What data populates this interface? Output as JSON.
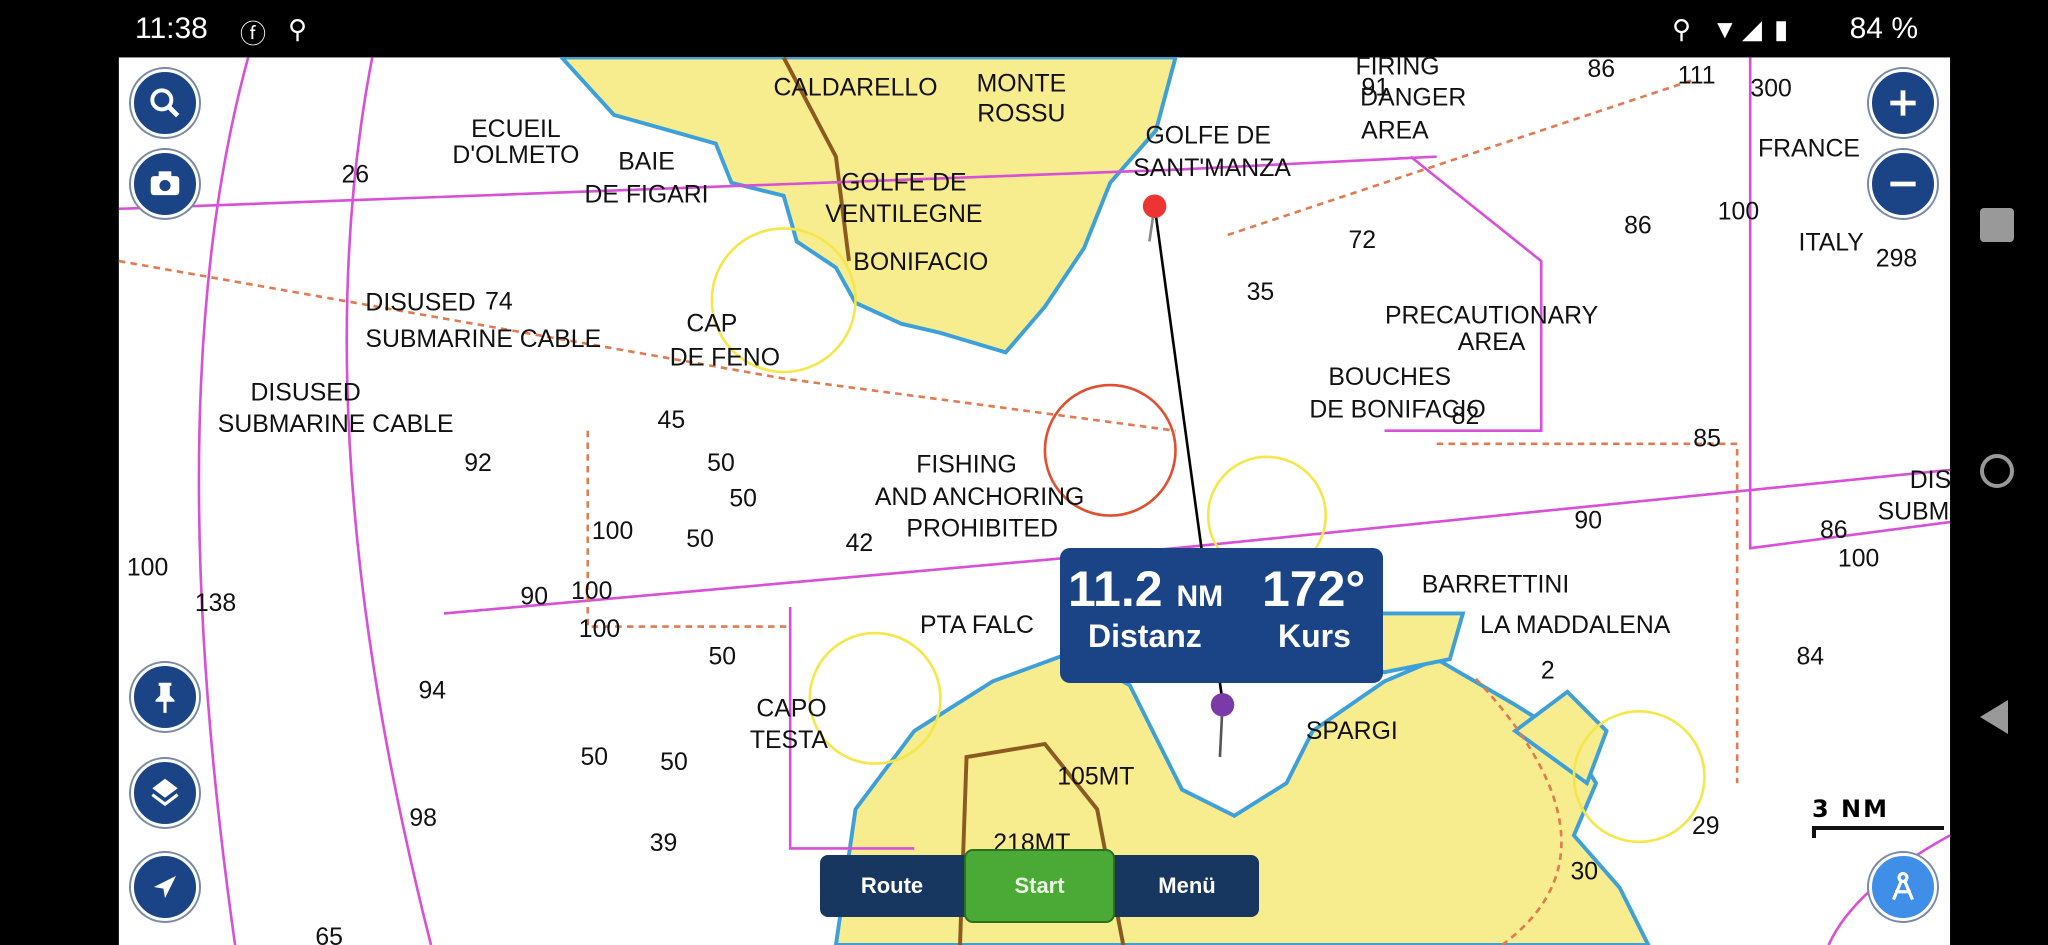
{
  "status_bar": {
    "time": "11:38",
    "battery": "84 %",
    "icons": [
      "facebook-icon",
      "location-icon",
      "location-outline-icon",
      "wifi-icon",
      "signal-icon",
      "battery-icon"
    ]
  },
  "map": {
    "labels": [
      "ECUEIL",
      "D'OLMETO",
      "BAIE",
      "DE FIGARI",
      "MONTE",
      "ROSSU",
      "CALDARELLO",
      "GOLFE DE",
      "SANT'MANZA",
      "FIRING",
      "DANGER",
      "AREA",
      "FRANCE",
      "ITALY",
      "GOLFE DE",
      "VENTILEGNE",
      "BONIFACIO",
      "DISUSED",
      "SUBMARINE CABLE",
      "DISUSED",
      "SUBMARINE CABLE",
      "CAP",
      "DE FENO",
      "PRECAUTIONARY",
      "AREA",
      "BOUCHES",
      "DE BONIFACIO",
      "FISHING",
      "AND ANCHORING",
      "PROHIBITED",
      "BARRETTINI",
      "LA MADDALENA",
      "PTA FALC",
      "CAPO",
      "TESTA",
      "SPARGI",
      "105MT",
      "218MT",
      "DIS",
      "SUBM"
    ],
    "depths": [
      "26",
      "74",
      "91",
      "86",
      "111",
      "300",
      "100",
      "86",
      "72",
      "298",
      "35",
      "45",
      "92",
      "50",
      "50",
      "100",
      "50",
      "42",
      "85",
      "90",
      "86",
      "100",
      "100",
      "138",
      "90",
      "100",
      "100",
      "50",
      "84",
      "94",
      "50",
      "50",
      "98",
      "39",
      "29",
      "30",
      "2",
      "82",
      "65"
    ],
    "colors": {
      "land": "#f7ec8e",
      "sea": "#ffffff",
      "shallow": "#3ea0d8",
      "boundary": "#d84fd8",
      "cable": "#e07a50"
    }
  },
  "measure": {
    "distance_value": "11.2",
    "distance_unit": "NM",
    "distance_label": "Distanz",
    "course_value": "172°",
    "course_label": "Kurs"
  },
  "bottom_bar": {
    "route": "Route",
    "start": "Start",
    "menu": "Menü"
  },
  "scale": "3 NM",
  "colors": {
    "button": "#1a4485",
    "start": "#4aaa35",
    "bar": "#173660",
    "compass": "#3f8fe8"
  }
}
